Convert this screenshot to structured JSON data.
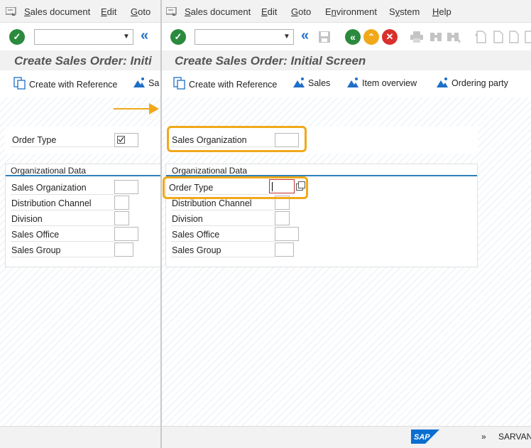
{
  "menu": {
    "items": [
      {
        "label": "Sales document",
        "ul": "S",
        "rest": "ales document"
      },
      {
        "label": "Edit",
        "ul": "E",
        "rest": "dit"
      },
      {
        "label": "Goto",
        "ul": "G",
        "rest": "oto"
      },
      {
        "label": "Environment",
        "ul": "n",
        "pre": "E",
        "rest": "vironment"
      },
      {
        "label": "System",
        "ul": "y",
        "pre": "S",
        "rest": "stem"
      },
      {
        "label": "Help",
        "ul": "H",
        "rest": "elp"
      }
    ]
  },
  "left": {
    "title": "Create Sales Order: Initi",
    "app_buttons": {
      "create_ref": "Create with Reference",
      "sales": "Sa"
    },
    "order_type_label": "Order Type",
    "group_title": "Organizational Data",
    "fields": [
      "Sales Organization",
      "Distribution Channel",
      "Division",
      "Sales Office",
      "Sales Group"
    ]
  },
  "right": {
    "title": "Create Sales Order: Initial Screen",
    "app_buttons": {
      "create_ref": "Create with Reference",
      "sales": "Sales",
      "item_overview": "Item overview",
      "ordering_party": "Ordering party"
    },
    "sales_org_label": "Sales Organization",
    "group_title": "Organizational Data",
    "order_type_label": "Order Type",
    "fields": [
      "Distribution Channel",
      "Division",
      "Sales Office",
      "Sales Group"
    ]
  },
  "status": {
    "logo": "SAP",
    "chevron": "»",
    "system": "SARVAN"
  },
  "colors": {
    "accent": "#f0a91b",
    "sap_blue": "#0a6ed1",
    "check_green": "#2b8a3e"
  }
}
